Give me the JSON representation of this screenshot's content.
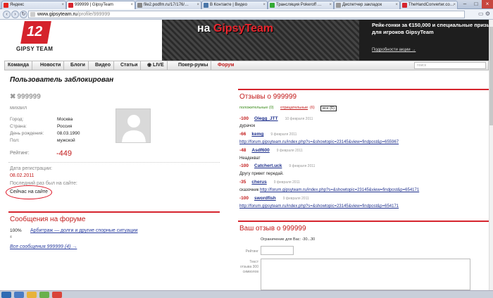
{
  "browser": {
    "tabs": [
      {
        "label": "Яндекс",
        "fav": "#e52620"
      },
      {
        "label": "999999 | GipsyTeam",
        "fav": "#d6252e"
      },
      {
        "label": "file2.podfm.ru/17/176/…",
        "fav": "#888"
      },
      {
        "label": "В Контакте | Видео",
        "fav": "#4a76a8"
      },
      {
        "label": "Трансляция Pokeroff …",
        "fav": "#3a3"
      },
      {
        "label": "Диспетчер закладок",
        "fav": "#999"
      },
      {
        "label": "TheHandConverter.co…",
        "fav": "#d6252e"
      }
    ],
    "url_domain": "www.gipsyteam.ru",
    "url_path": "/profile/999999"
  },
  "logo": {
    "text": "GIPSY TEAM",
    "num": "12"
  },
  "promo": {
    "title_a": "на",
    "title_b": "GipsyTeam",
    "text": "Рейк-гонки за €150,000 и специальные призы для игроков GipsyTeam",
    "link": "Подробности акции →"
  },
  "menu": {
    "items": [
      "Команда",
      "Новости",
      "Блоги",
      "Видео",
      "Статьи",
      "◉ LIVE",
      "Покер-румы",
      "Форум"
    ],
    "search_placeholder": "поиск"
  },
  "profile": {
    "blocked_title": "Пользователь заблокирован",
    "username": "999999",
    "realname": "михаил",
    "fields": [
      {
        "label": "Город:",
        "value": "Москва"
      },
      {
        "label": "Страна:",
        "value": "Россия"
      },
      {
        "label": "День рождения:",
        "value": "08.03.1990"
      },
      {
        "label": "Пол:",
        "value": "мужской"
      }
    ],
    "rating_label": "Рейтинг:",
    "rating_value": "-449",
    "reg_label": "Дата регистрации:",
    "reg_value": "08.02.2011",
    "last_label": "Последний раз был на сайте:",
    "online": "Сейчас на сайте"
  },
  "forum": {
    "title": "Сообщения на форуме",
    "pct": "100%",
    "pct_value": 100,
    "topic": "Арбитраж — долги и другие спорные ситуации",
    "count": "4",
    "all_link": "Все сообщения 999999 (4) →"
  },
  "reviews": {
    "title": "Отзывы о 999999",
    "tab_pos": "положительные (0)",
    "tab_neg": "отрицательные",
    "tab_neg_count": "(6)",
    "tab_all": "все",
    "tab_all_count": "(6)",
    "items": [
      {
        "score": "-100",
        "name": "Olegg_JTT",
        "date": "10 февраля 2011",
        "text": "дурачок",
        "link": ""
      },
      {
        "score": "-66",
        "name": "kemg",
        "date": "9 февраля 2011",
        "text": "",
        "link": "http://forum.gipsyteam.ru/index.php?s=&showtopic=23145&view=findpost&p=655967"
      },
      {
        "score": "-48",
        "name": "Asdf600",
        "date": "9 февраля 2011",
        "text": "Неадекват",
        "link": ""
      },
      {
        "score": "-100",
        "name": "Catchert.uck",
        "date": "9 февраля 2011",
        "text": "Другу привет передай.",
        "link": ""
      },
      {
        "score": "-35",
        "name": "cherus",
        "date": "9 февраля 2011",
        "text": "сказочник",
        "link": "http://forum.gipsyteam.ru/index.php?s=&showtopic=23145&view=findpost&p=654171"
      },
      {
        "score": "-100",
        "name": "swordfish",
        "date": "9 февраля 2011",
        "text": "",
        "link": "http://forum.gipsyteam.ru/index.php?s=&showtopic=23145&view=findpost&p=654171"
      }
    ]
  },
  "your_review": {
    "title": "Ваш отзыв о 999999",
    "limit": "Ограничение для Вас: -30...30",
    "rating_label": "Рейтинг",
    "text_label": "Текст отзыва 300 символов"
  }
}
